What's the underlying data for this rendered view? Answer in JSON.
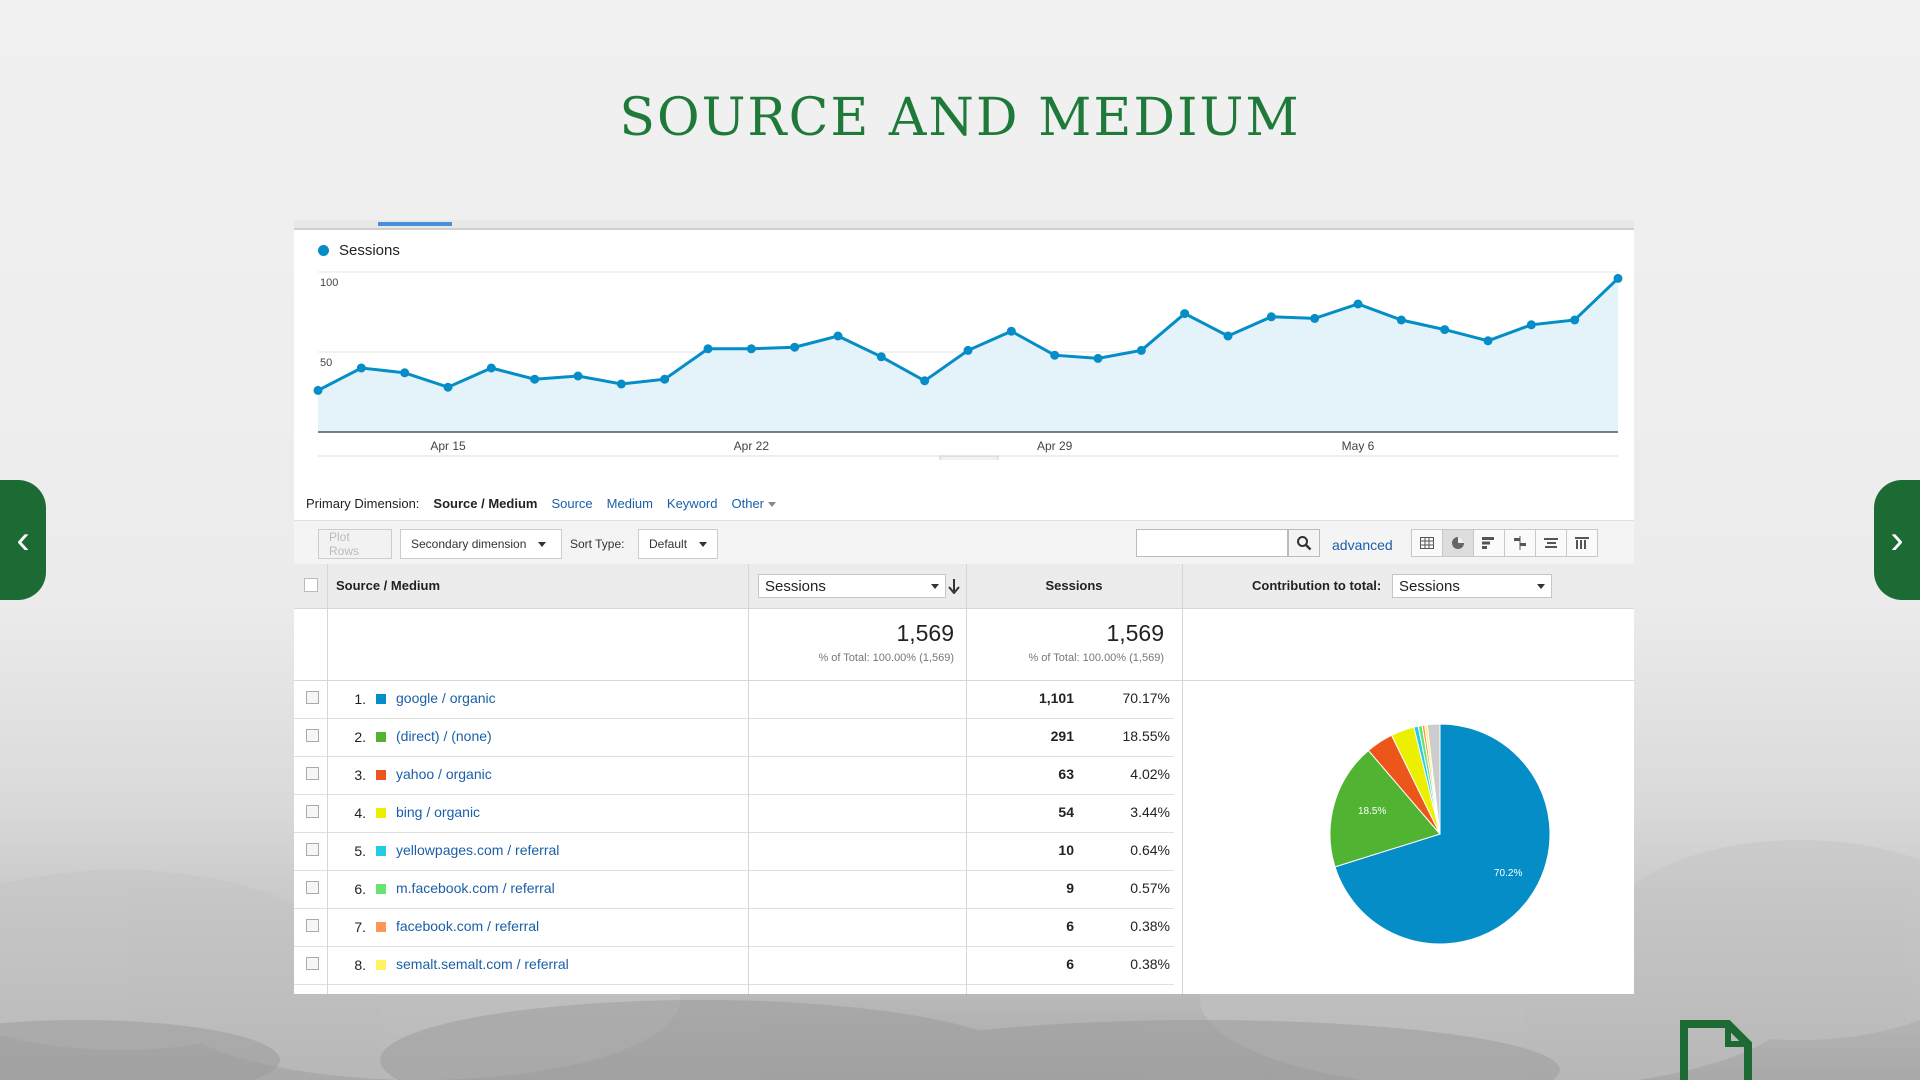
{
  "page": {
    "title": "SOURCE AND MEDIUM"
  },
  "chart": {
    "legend": "Sessions",
    "color": "#058dc7",
    "fill": "#e4f2f9"
  },
  "chart_data": {
    "type": "line",
    "series": [
      {
        "name": "Sessions",
        "values": [
          26,
          40,
          37,
          28,
          40,
          33,
          35,
          30,
          33,
          52,
          52,
          53,
          60,
          47,
          32,
          51,
          63,
          48,
          46,
          51,
          74,
          60,
          72,
          71,
          80,
          70,
          64,
          57,
          67,
          70,
          96
        ]
      }
    ],
    "x_tick_labels": [
      "Apr 15",
      "Apr 22",
      "Apr 29",
      "May 6"
    ],
    "y_ticks": [
      100,
      50
    ],
    "ylim": [
      0,
      100
    ]
  },
  "dimensions": {
    "label": "Primary Dimension:",
    "selected": "Source / Medium",
    "links": [
      "Source",
      "Medium",
      "Keyword",
      "Other"
    ]
  },
  "toolbar": {
    "plot_rows": "Plot Rows",
    "secondary_dimension": "Secondary dimension",
    "sort_type_label": "Sort Type:",
    "sort_type_value": "Default",
    "search_value": "",
    "advanced": "advanced"
  },
  "table": {
    "col_source": "Source / Medium",
    "metric_select": "Sessions",
    "col_sessions": "Sessions",
    "contribution_label": "Contribution to total:",
    "contribution_select": "Sessions",
    "total_sessions": "1,569",
    "total_sub": "% of Total: 100.00% (1,569)",
    "total_pct_value": "1,569",
    "total_pct_sub": "% of Total: 100.00% (1,569)",
    "rows": [
      {
        "idx": "1.",
        "color": "#058dc7",
        "source": "google / organic",
        "sessions": "1,101",
        "pct": "70.17%"
      },
      {
        "idx": "2.",
        "color": "#50b432",
        "source": "(direct) / (none)",
        "sessions": "291",
        "pct": "18.55%"
      },
      {
        "idx": "3.",
        "color": "#ed561b",
        "source": "yahoo / organic",
        "sessions": "63",
        "pct": "4.02%"
      },
      {
        "idx": "4.",
        "color": "#edef00",
        "source": "bing / organic",
        "sessions": "54",
        "pct": "3.44%"
      },
      {
        "idx": "5.",
        "color": "#24cbe5",
        "source": "yellowpages.com / referral",
        "sessions": "10",
        "pct": "0.64%"
      },
      {
        "idx": "6.",
        "color": "#64e572",
        "source": "m.facebook.com / referral",
        "sessions": "9",
        "pct": "0.57%"
      },
      {
        "idx": "7.",
        "color": "#ff9655",
        "source": "facebook.com / referral",
        "sessions": "6",
        "pct": "0.38%"
      },
      {
        "idx": "8.",
        "color": "#fff263",
        "source": "semalt.semalt.com / referral",
        "sessions": "6",
        "pct": "0.38%"
      }
    ]
  },
  "pie": {
    "slices": [
      70.17,
      18.55,
      4.02,
      3.44,
      0.64,
      0.57,
      0.38,
      0.38,
      1.85
    ],
    "colors": [
      "#058dc7",
      "#50b432",
      "#ed561b",
      "#edef00",
      "#24cbe5",
      "#64e572",
      "#ff9655",
      "#fff263",
      "#cccccc"
    ],
    "label_big": "70.2%",
    "label_second": "18.5%"
  }
}
